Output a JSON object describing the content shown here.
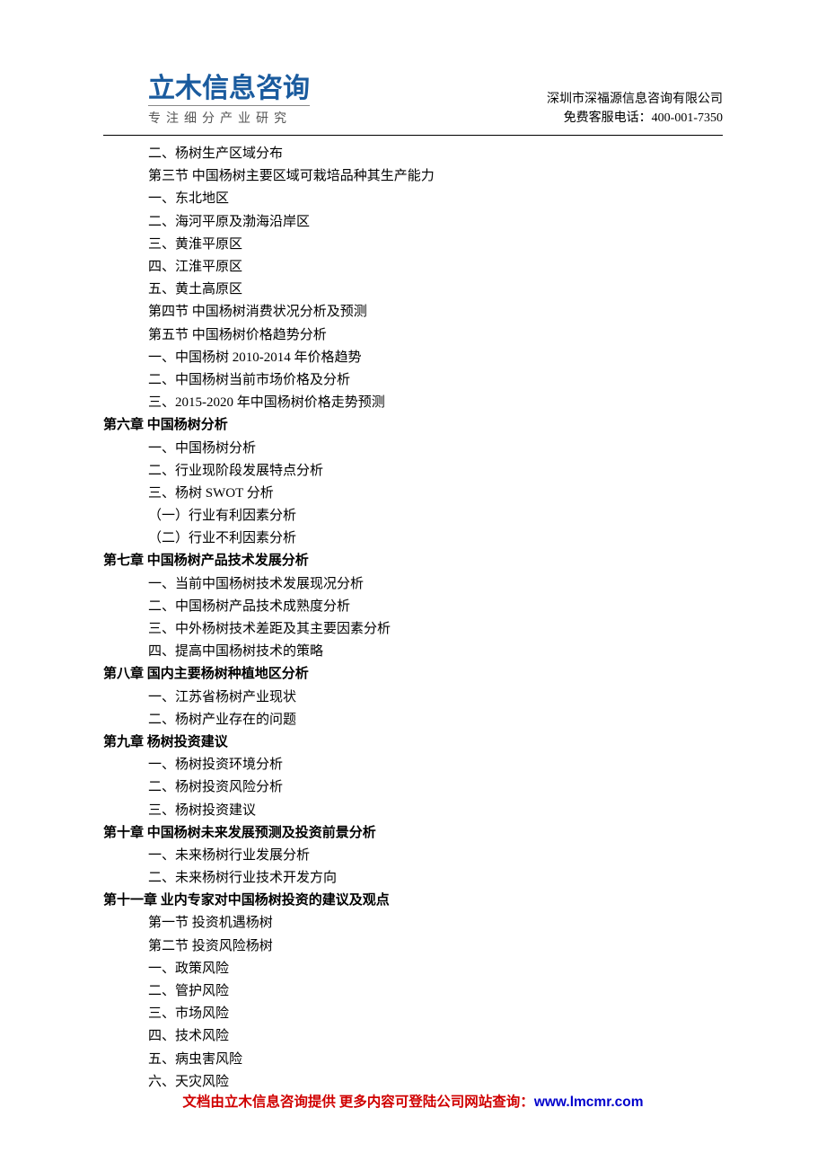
{
  "header": {
    "logo_main": "立木信息咨询",
    "logo_sub": "专注细分产业研究",
    "company": "深圳市深福源信息咨询有限公司",
    "hotline_label": "免费客服电话：",
    "hotline_number": "400-001-7350"
  },
  "toc": [
    {
      "text": "二、杨树生产区域分布",
      "level": "item"
    },
    {
      "text": "第三节 中国杨树主要区域可栽培品种其生产能力",
      "level": "item"
    },
    {
      "text": "一、东北地区",
      "level": "item"
    },
    {
      "text": "二、海河平原及渤海沿岸区",
      "level": "item"
    },
    {
      "text": "三、黄淮平原区",
      "level": "item"
    },
    {
      "text": "四、江淮平原区",
      "level": "item"
    },
    {
      "text": "五、黄土高原区",
      "level": "item"
    },
    {
      "text": "第四节 中国杨树消费状况分析及预测",
      "level": "item"
    },
    {
      "text": "第五节 中国杨树价格趋势分析",
      "level": "item"
    },
    {
      "text": "一、中国杨树 2010-2014 年价格趋势",
      "level": "item"
    },
    {
      "text": "二、中国杨树当前市场价格及分析",
      "level": "item"
    },
    {
      "text": "三、2015-2020 年中国杨树价格走势预测",
      "level": "item"
    },
    {
      "text": "第六章 中国杨树分析",
      "level": "chapter"
    },
    {
      "text": "一、中国杨树分析",
      "level": "item"
    },
    {
      "text": "二、行业现阶段发展特点分析",
      "level": "item"
    },
    {
      "text": "三、杨树 SWOT 分析",
      "level": "item"
    },
    {
      "text": "（一）行业有利因素分析",
      "level": "item"
    },
    {
      "text": "（二）行业不利因素分析",
      "level": "item"
    },
    {
      "text": "第七章   中国杨树产品技术发展分析",
      "level": "chapter"
    },
    {
      "text": "一、当前中国杨树技术发展现况分析",
      "level": "item"
    },
    {
      "text": "二、中国杨树产品技术成熟度分析",
      "level": "item"
    },
    {
      "text": "三、中外杨树技术差距及其主要因素分析",
      "level": "item"
    },
    {
      "text": "四、提高中国杨树技术的策略",
      "level": "item"
    },
    {
      "text": "第八章 国内主要杨树种植地区分析",
      "level": "chapter"
    },
    {
      "text": "一、江苏省杨树产业现状",
      "level": "item"
    },
    {
      "text": "二、杨树产业存在的问题",
      "level": "item"
    },
    {
      "text": "第九章 杨树投资建议",
      "level": "chapter"
    },
    {
      "text": "一、杨树投资环境分析",
      "level": "item"
    },
    {
      "text": "二、杨树投资风险分析",
      "level": "item"
    },
    {
      "text": "三、杨树投资建议",
      "level": "item"
    },
    {
      "text": "第十章 中国杨树未来发展预测及投资前景分析",
      "level": "chapter"
    },
    {
      "text": "一、未来杨树行业发展分析",
      "level": "item"
    },
    {
      "text": "二、未来杨树行业技术开发方向",
      "level": "item"
    },
    {
      "text": "第十一章 业内专家对中国杨树投资的建议及观点",
      "level": "chapter"
    },
    {
      "text": "第一节 投资机遇杨树",
      "level": "item"
    },
    {
      "text": "第二节 投资风险杨树",
      "level": "item"
    },
    {
      "text": "一、政策风险",
      "level": "item"
    },
    {
      "text": "二、管护风险",
      "level": "item"
    },
    {
      "text": "三、市场风险",
      "level": "item"
    },
    {
      "text": "四、技术风险",
      "level": "item"
    },
    {
      "text": "五、病虫害风险",
      "level": "item"
    },
    {
      "text": "六、天灾风险",
      "level": "item"
    }
  ],
  "footer": {
    "text": "文档由立木信息咨询提供 更多内容可登陆公司网站查询：",
    "url": "www.lmcmr.com"
  }
}
